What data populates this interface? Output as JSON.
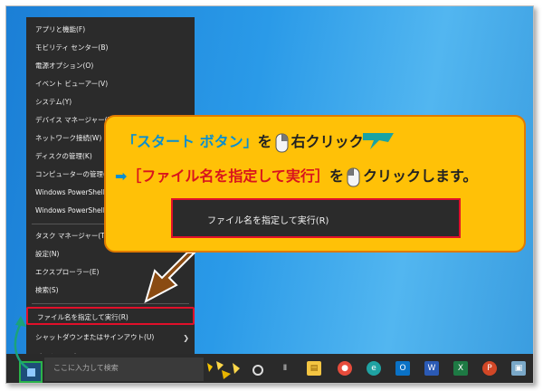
{
  "menu": {
    "items": [
      "アプリと機能(F)",
      "モビリティ センター(B)",
      "電源オプション(O)",
      "イベント ビューアー(V)",
      "システム(Y)",
      "デバイス マネージャー(M)",
      "ネットワーク接続(W)",
      "ディスクの管理(K)",
      "コンピューターの管理(G)",
      "Windows PowerShell(I)",
      "Windows PowerShell (管理者)(A)",
      "タスク マネージャー(T)",
      "設定(N)",
      "エクスプローラー(E)",
      "検索(S)",
      "ファイル名を指定して実行(R)",
      "シャットダウンまたはサインアウト(U)",
      "デスクトップ(D)"
    ]
  },
  "callout": {
    "l1_open": "「スタート ボタン」",
    "l1_wo": "を",
    "l1_right": "右クリック",
    "l2_arrow": "➡",
    "l2_item": "［ファイル名を指定して実行］",
    "l2_wo": "を",
    "l2_action": "クリックします。",
    "run_label": "ファイル名を指定して実行(R)"
  },
  "taskbar": {
    "search_placeholder": "ここに入力して検索"
  },
  "colors": {
    "callout_bg": "#ffc107",
    "highlight": "#e0102a",
    "start_highlight": "#2bb34a"
  }
}
